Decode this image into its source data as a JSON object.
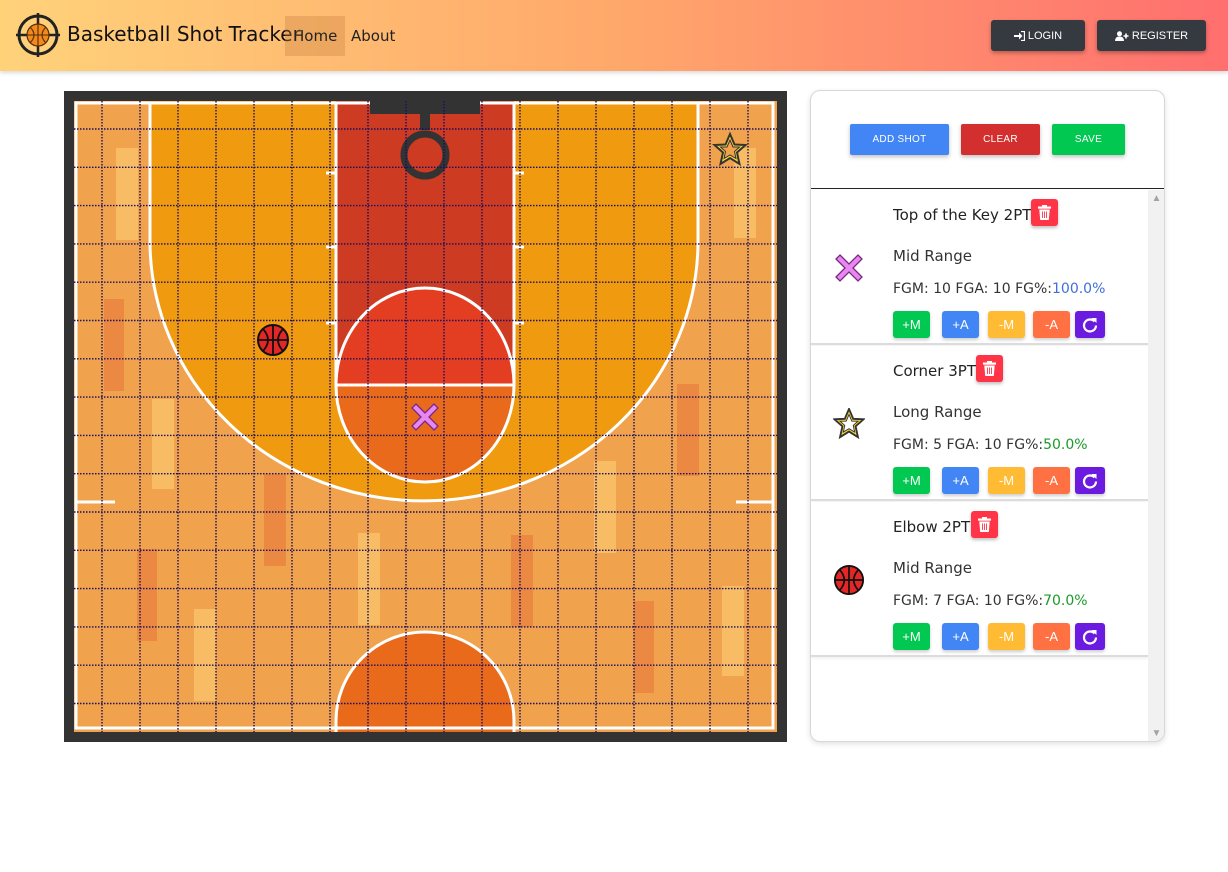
{
  "navbar": {
    "brand": "Basketball Shot Tracker",
    "links": [
      {
        "label": "Home",
        "active": true
      },
      {
        "label": "About",
        "active": false
      }
    ],
    "login_label": "LOGIN",
    "register_label": "REGISTER",
    "login_icon": "sign-in-icon",
    "register_icon": "user-plus-icon"
  },
  "court": {
    "markers": [
      {
        "shot": "Top of the Key 2PT",
        "icon": "x-marker-icon",
        "color": "#e887f2"
      },
      {
        "shot": "Corner 3PT",
        "icon": "star-marker-icon",
        "color": "#ffd93b"
      },
      {
        "shot": "Elbow 2PT",
        "icon": "basketball-marker-icon",
        "color": "#e32727"
      }
    ],
    "colors": {
      "floor": "#f0a24d",
      "three_point_area": "#f09a10",
      "paint": "#cc3b22",
      "free_throw_circle": "#e86a1a",
      "border": "#333333",
      "grid_line": "#1a1060"
    }
  },
  "panel": {
    "add_label": "ADD SHOT",
    "clear_label": "CLEAR",
    "save_label": "SAVE",
    "shots": [
      {
        "title": "Top of the Key 2PT",
        "range": "Mid Range",
        "stats": "FGM: 10 FGA: 10 FG%:",
        "pct": "100.0%",
        "icon": "x-marker-icon"
      },
      {
        "title": "Corner 3PT",
        "range": "Long Range",
        "stats": "FGM: 5 FGA: 10 FG%:",
        "pct": "50.0%",
        "icon": "star-marker-icon"
      },
      {
        "title": "Elbow 2PT",
        "range": "Mid Range",
        "stats": "FGM: 7 FGA: 10 FG%:",
        "pct": "70.0%",
        "icon": "basketball-marker-icon"
      }
    ],
    "stat_buttons": {
      "plus_make": "+M",
      "plus_attempt": "+A",
      "minus_make": "-M",
      "minus_attempt": "-A",
      "reset_icon": "reset-icon"
    },
    "colors": {
      "add": "#4285f4",
      "clear": "#d32f2f",
      "save": "#00c851",
      "delete": "#ff3547",
      "plus_make": "#00c851",
      "plus_attempt": "#4285f4",
      "minus_make": "#ffbb33",
      "minus_attempt": "#ff7043",
      "reset": "#6a1bdf"
    }
  }
}
